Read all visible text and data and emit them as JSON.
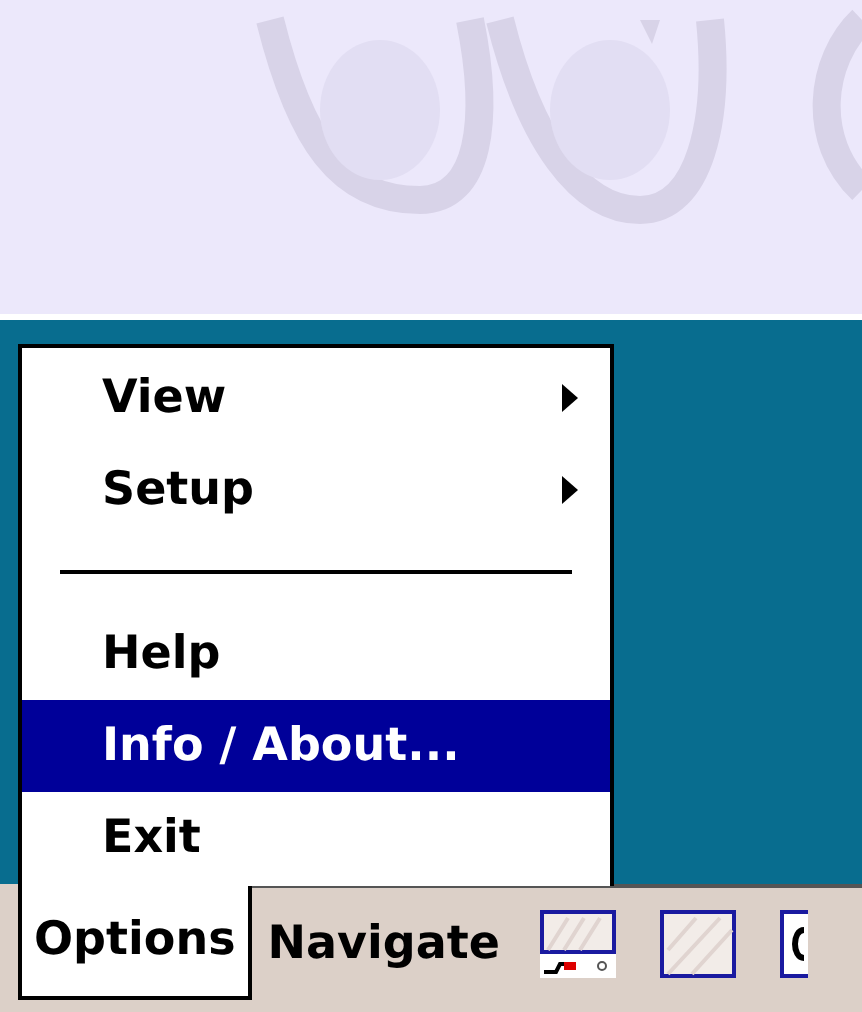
{
  "menu": {
    "items": [
      {
        "kind": "submenu",
        "label": "View",
        "selected": false
      },
      {
        "kind": "submenu",
        "label": "Setup",
        "selected": false
      },
      {
        "kind": "separator"
      },
      {
        "kind": "item",
        "label": "Help",
        "selected": false
      },
      {
        "kind": "item",
        "label": "Info / About...",
        "selected": true
      },
      {
        "kind": "item",
        "label": "Exit",
        "selected": false
      }
    ]
  },
  "menu_bar": {
    "menus": [
      {
        "label": "Options",
        "selected": true
      },
      {
        "label": "Navigate",
        "selected": false
      }
    ]
  }
}
